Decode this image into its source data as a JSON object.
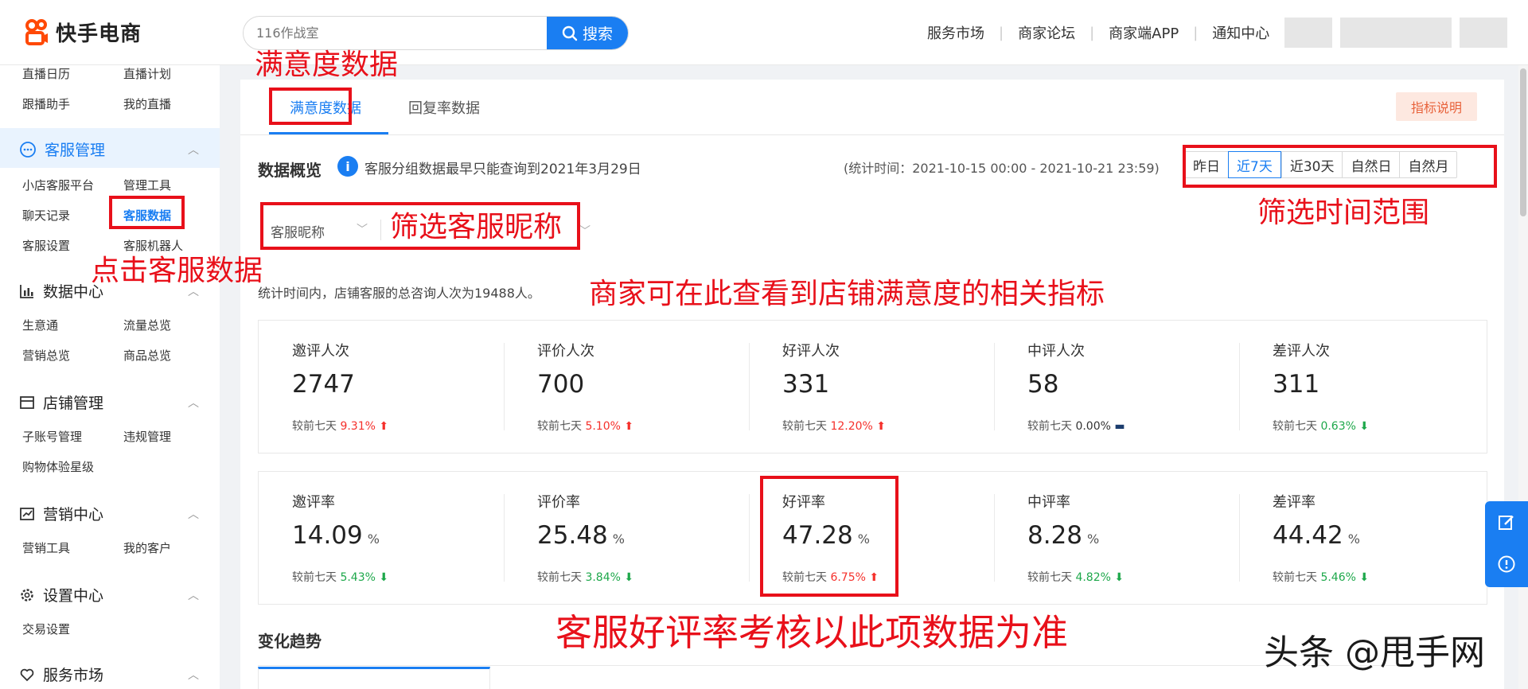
{
  "header": {
    "logo_text": "快手电商",
    "search_placeholder": "116作战室",
    "search_button": "搜索",
    "nav": [
      "服务市场",
      "商家论坛",
      "商家端APP",
      "通知中心"
    ]
  },
  "sidebar": {
    "top_items": [
      "直播日历",
      "直播计划",
      "跟播助手",
      "我的直播"
    ],
    "sections": [
      {
        "title": "客服管理",
        "icon": "chat-icon",
        "items": [
          "小店客服平台",
          "管理工具",
          "聊天记录",
          "客服数据",
          "客服设置",
          "客服机器人"
        ]
      },
      {
        "title": "数据中心",
        "icon": "bar-chart-icon",
        "items": [
          "生意通",
          "流量总览",
          "营销总览",
          "商品总览"
        ]
      },
      {
        "title": "店铺管理",
        "icon": "shop-icon",
        "items": [
          "子账号管理",
          "违规管理",
          "购物体验星级"
        ]
      },
      {
        "title": "营销中心",
        "icon": "trend-icon",
        "items": [
          "营销工具",
          "我的客户"
        ]
      },
      {
        "title": "设置中心",
        "icon": "gear-icon",
        "items": [
          "交易设置"
        ]
      },
      {
        "title": "服务市场",
        "icon": "heart-icon",
        "items": []
      }
    ]
  },
  "tabs": [
    "满意度数据",
    "回复率数据"
  ],
  "indicator_button": "指标说明",
  "overview": {
    "title": "数据概览",
    "info": "客服分组数据最早只能查询到2021年3月29日",
    "stat_time": "(统计时间：2021-10-15 00:00 - 2021-10-21 23:59)",
    "ranges": [
      "昨日",
      "近7天",
      "近30天",
      "自然日",
      "自然月"
    ],
    "selected_range": "近7天",
    "filter_label": "客服昵称",
    "total_line": "统计时间内，店铺客服的总咨询人次为19488人。"
  },
  "counts": [
    {
      "label": "邀评人次",
      "value": "2747",
      "cmp_label": "较前七天",
      "cmp": "9.31%",
      "dir": "up"
    },
    {
      "label": "评价人次",
      "value": "700",
      "cmp_label": "较前七天",
      "cmp": "5.10%",
      "dir": "up"
    },
    {
      "label": "好评人次",
      "value": "331",
      "cmp_label": "较前七天",
      "cmp": "12.20%",
      "dir": "up"
    },
    {
      "label": "中评人次",
      "value": "58",
      "cmp_label": "较前七天",
      "cmp": "0.00%",
      "dir": "flat"
    },
    {
      "label": "差评人次",
      "value": "311",
      "cmp_label": "较前七天",
      "cmp": "0.63%",
      "dir": "down"
    }
  ],
  "rates": [
    {
      "label": "邀评率",
      "value": "14.09",
      "unit": "%",
      "cmp_label": "较前七天",
      "cmp": "5.43%",
      "dir": "down"
    },
    {
      "label": "评价率",
      "value": "25.48",
      "unit": "%",
      "cmp_label": "较前七天",
      "cmp": "3.84%",
      "dir": "down"
    },
    {
      "label": "好评率",
      "value": "47.28",
      "unit": "%",
      "cmp_label": "较前七天",
      "cmp": "6.75%",
      "dir": "up"
    },
    {
      "label": "中评率",
      "value": "8.28",
      "unit": "%",
      "cmp_label": "较前七天",
      "cmp": "4.82%",
      "dir": "down"
    },
    {
      "label": "差评率",
      "value": "44.42",
      "unit": "%",
      "cmp_label": "较前七天",
      "cmp": "5.46%",
      "dir": "down"
    }
  ],
  "trend_title": "变化趋势",
  "annotations": {
    "satisfaction": "满意度数据",
    "click_cs_data": "点击客服数据",
    "filter_nick": "筛选客服昵称",
    "filter_time": "筛选时间范围",
    "metrics_note": "商家可在此查看到店铺满意度的相关指标",
    "rate_note": "客服好评率考核以此项数据为准",
    "color": "#e8101a"
  },
  "watermark": "头条 @甩手网",
  "colors": {
    "accent": "#1a7ef2",
    "up": "#f5302b",
    "down": "#1ea84b"
  }
}
